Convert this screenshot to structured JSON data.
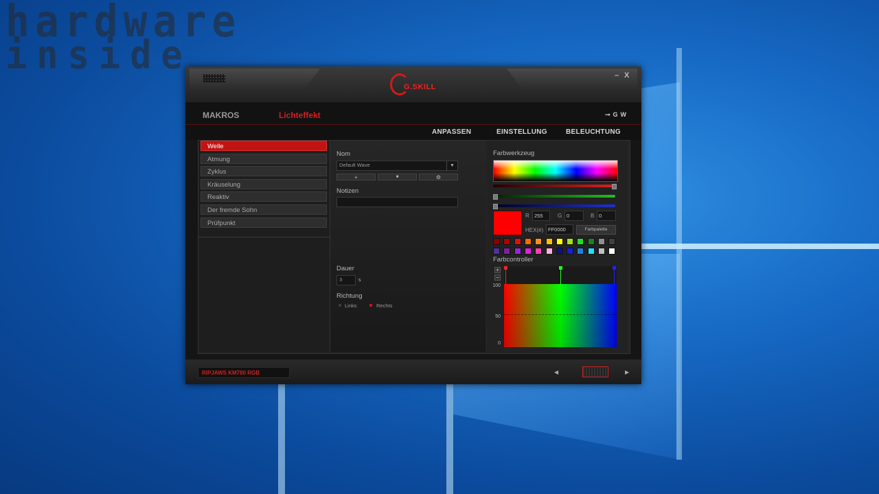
{
  "watermark": {
    "line1": "hardware",
    "line2": "inside"
  },
  "window": {
    "logo_text": "G.SKILL",
    "minimize": "–",
    "close": "X"
  },
  "nav": {
    "tabs": [
      {
        "label": "MAKROS",
        "color": "#9a9a9a"
      },
      {
        "label": "Lichteffekt",
        "color": "#d42020"
      }
    ],
    "icons": {
      "usb": "⊸",
      "g": "G",
      "w": "W"
    }
  },
  "subnav": [
    "ANPASSEN",
    "EINSTELLUNG",
    "BELEUCHTUNG"
  ],
  "effects": [
    {
      "label": "Welle",
      "active": true
    },
    {
      "label": "Atmung"
    },
    {
      "label": "Zyklus"
    },
    {
      "label": "Kräuselung"
    },
    {
      "label": "Reaktiv"
    },
    {
      "label": "Der fremde Sohn"
    },
    {
      "label": "Prüfpunkt"
    }
  ],
  "settings": {
    "name_label": "Nom",
    "name_value": "Default Wave",
    "dropdown_arrow": "▼",
    "btn_add": "+",
    "btn_lock": "■",
    "btn_gear": "⚙",
    "notes_label": "Notizen",
    "notes_value": "",
    "duration_label": "Dauer",
    "duration_value": "3",
    "duration_unit": "s",
    "direction_label": "Richtung",
    "dir_left": "Links",
    "dir_right": "Rechts"
  },
  "color_tool": {
    "title": "Farbwerkzeug",
    "r_label": "R",
    "r_value": "255",
    "g_label": "G",
    "g_value": "0",
    "b_label": "B",
    "b_value": "0",
    "hex_label": "HEX(#)",
    "hex_value": "FF0000",
    "palette_button": "Farbpalette",
    "current_color": "#ff0000",
    "sliders": {
      "r": 1.0,
      "g": 0.0,
      "b": 0.0
    },
    "swatches_row1": [
      "#8b0000",
      "#b00000",
      "#e01010",
      "#ff6a00",
      "#ff9020",
      "#ffc000",
      "#ffff00",
      "#a0e020",
      "#20e020",
      "#208020",
      "#909090",
      "#404040"
    ],
    "swatches_row2": [
      "#5030a0",
      "#8020a0",
      "#a020e0",
      "#e020e0",
      "#ff40b0",
      "#ffb0e0",
      "#101080",
      "#1020e0",
      "#2080e0",
      "#20e0ff",
      "#c0c0c0",
      "#ffffff"
    ]
  },
  "color_controller": {
    "title": "Farbcontroller",
    "plus": "+",
    "minus": "−",
    "y_100": "100",
    "y_50": "50",
    "y_0": "0"
  },
  "footer": {
    "device": "RIPJAWS KM780 RGB",
    "prev": "◀",
    "next": "▶"
  }
}
